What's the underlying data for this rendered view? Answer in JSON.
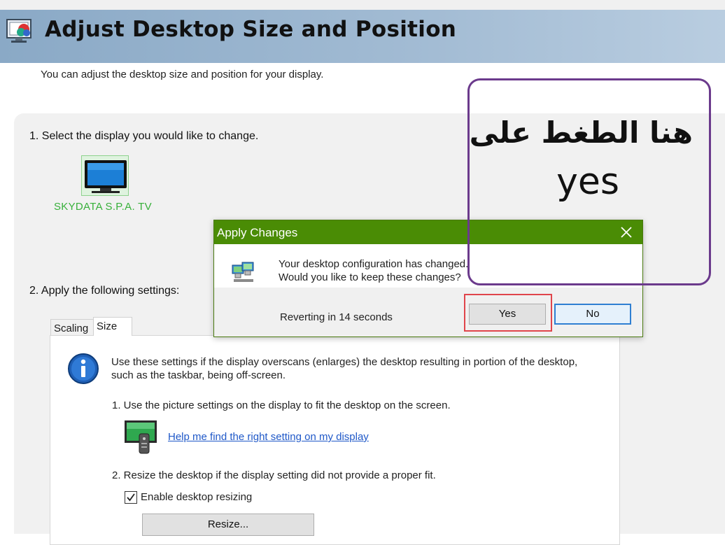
{
  "header": {
    "title": "Adjust Desktop Size and Position",
    "icon": "display-settings-icon"
  },
  "subtitle": "You can adjust the desktop size and position for your display.",
  "step1": {
    "label": "1. Select the display you would like to change.",
    "display_name": "SKYDATA S.P.A. TV"
  },
  "step2": {
    "label": "2. Apply the following settings:",
    "tabs": [
      {
        "label": "Scaling",
        "selected": false
      },
      {
        "label": "Size",
        "selected": true
      }
    ],
    "info_text": "Use these settings if the display overscans (enlarges) the desktop resulting in portion of the desktop, such as the taskbar, being off-screen.",
    "sub1": "1. Use the picture settings on the display to fit the desktop on the screen.",
    "help_link": "Help me find the right setting on my display",
    "sub2": "2. Resize the desktop if the display setting did not provide a proper fit.",
    "checkbox_label": "Enable desktop resizing",
    "checkbox_checked": true,
    "resize_button": "Resize..."
  },
  "dialog": {
    "title": "Apply Changes",
    "message_line1": "Your desktop configuration has changed.",
    "message_line2": "Would you like to keep these changes?",
    "revert_text": "Reverting in 14 seconds",
    "yes_button": "Yes",
    "no_button": "No",
    "titlebar_color": "#4a8c05"
  },
  "annotation": {
    "arabic_text": "هنا الطغط على",
    "english_text": "yes",
    "border_color": "#6b3a8c",
    "highlight_color": "#e0454b"
  }
}
